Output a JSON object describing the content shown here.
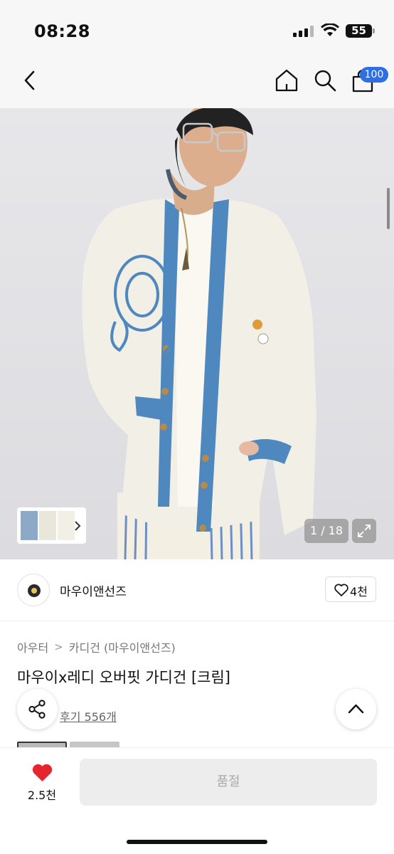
{
  "status_bar": {
    "time": "08:28",
    "battery": "55"
  },
  "nav": {
    "cart_count": "100"
  },
  "gallery": {
    "counter": "1 / 18"
  },
  "brand": {
    "name": "마우이앤선즈",
    "likes": "4천"
  },
  "breadcrumb": [
    "아우터",
    "카디건 (마우이앤선즈)"
  ],
  "product": {
    "title": "마우이x레디 오버핏 가디건 [크림]",
    "reviews": "후기 556개"
  },
  "bottom_bar": {
    "wishlist_count": "2.5천",
    "buy_label": "품절"
  },
  "colors": {
    "accent": "#2f6fe4",
    "heart": "#e5262f",
    "cardigan_trim": "#4f87bf",
    "knit": "#f1efe6"
  }
}
